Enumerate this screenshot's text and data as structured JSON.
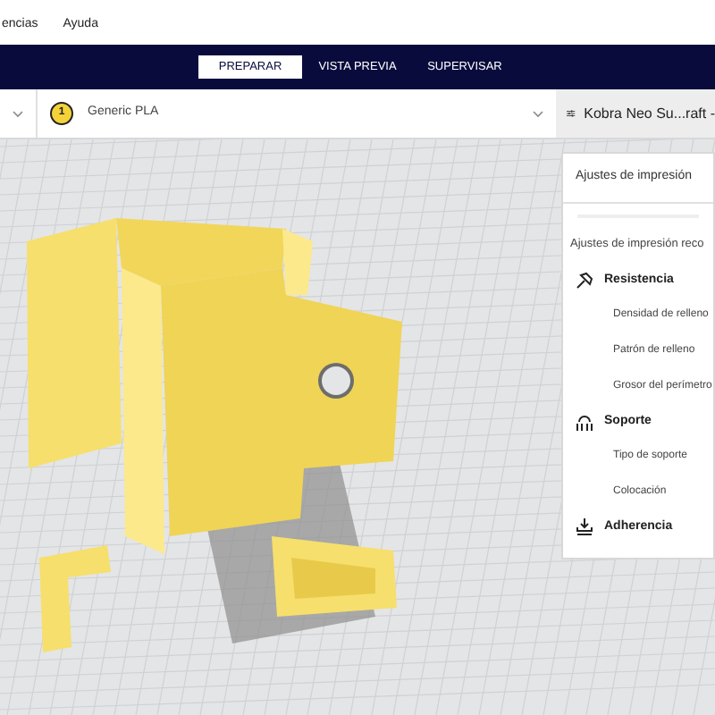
{
  "menu_bar": {
    "items": [
      "encias",
      "Ayuda"
    ]
  },
  "stage_tabs": [
    {
      "label": "PREPARAR",
      "selected": true
    },
    {
      "label": "VISTA PREVIA",
      "selected": false
    },
    {
      "label": "SUPERVISAR",
      "selected": false
    }
  ],
  "toolbar": {
    "extruder_number": "1",
    "material": "Generic PLA",
    "print_profile": "Kobra Neo Su...raft - "
  },
  "print_settings_panel": {
    "title": "Ajustes de impresión",
    "subtitle": "Ajustes de impresión reco",
    "sections": [
      {
        "kind": "strength",
        "title": "Resistencia",
        "items": [
          "Densidad de relleno",
          "Patrón de relleno",
          "Grosor del perímetro"
        ]
      },
      {
        "kind": "support",
        "title": "Soporte",
        "items": [
          "Tipo de soporte",
          "Colocación"
        ]
      },
      {
        "kind": "adhesion",
        "title": "Adherencia"
      }
    ]
  }
}
